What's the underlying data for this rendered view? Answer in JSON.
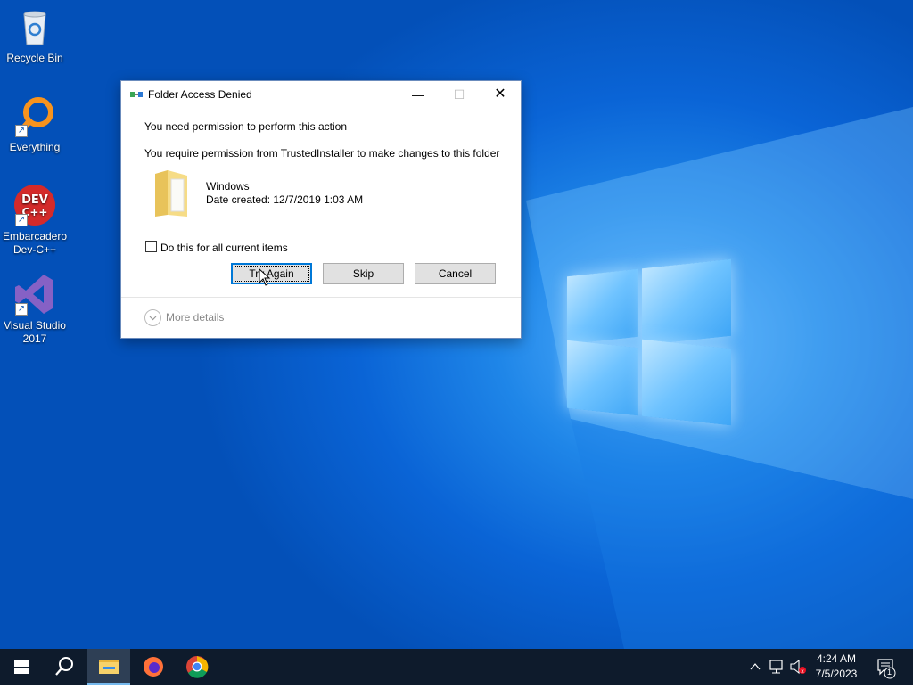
{
  "desktop": {
    "icons": [
      {
        "label": "Recycle Bin"
      },
      {
        "label": "Everything"
      },
      {
        "label": "Embarcadero Dev-C++"
      },
      {
        "label": "Visual Studio 2017"
      }
    ]
  },
  "dialog": {
    "title": "Folder Access Denied",
    "heading": "You need permission to perform this action",
    "message": "You require permission from TrustedInstaller to make changes to this folder",
    "item_name": "Windows",
    "item_date": "Date created: 12/7/2019 1:03 AM",
    "checkbox_label": "Do this for all current items",
    "checkbox_checked": false,
    "buttons": {
      "try_again": "Try Again",
      "skip": "Skip",
      "cancel": "Cancel"
    },
    "more_details": "More details"
  },
  "taskbar": {
    "clock_time": "4:24 AM",
    "clock_date": "7/5/2023",
    "notification_count": "1"
  },
  "colors": {
    "accent": "#0078d7",
    "taskbar": "#0e1b2c",
    "desktop": "#0a64d6"
  }
}
